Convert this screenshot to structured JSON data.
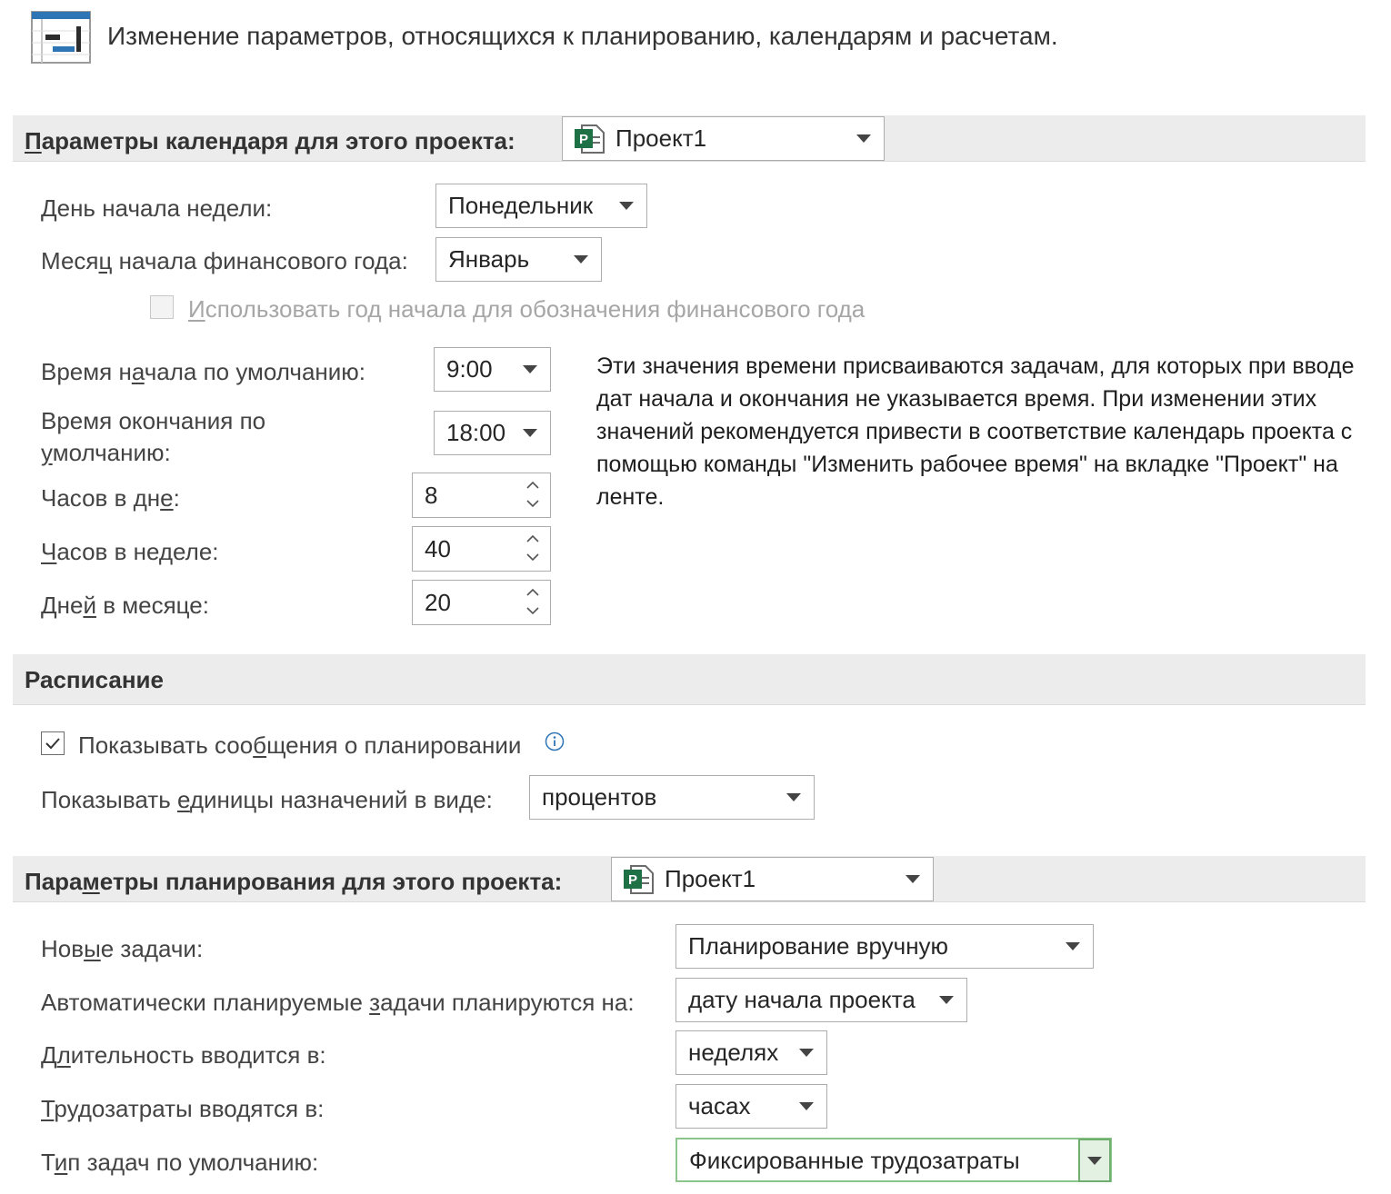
{
  "header": {
    "text": "Изменение параметров, относящихся к планированию, календарям и расчетам."
  },
  "calendar": {
    "title_first": "П",
    "title_rest": "араметры календаря для этого проекта:",
    "project": "Проект1",
    "week_start": {
      "label": "День начала недели:",
      "value": "Понедельник"
    },
    "fiscal_month": {
      "label_a": "Меся",
      "label_u": "ц",
      "label_b": " начала финансового года:",
      "value": "Январь"
    },
    "use_start_year": {
      "label_u": "И",
      "label_rest": "спользовать год начала для обозначения финансового года",
      "checked": false
    },
    "default_start": {
      "label_a": "Время н",
      "label_u": "а",
      "label_b": "чала по умолчанию:",
      "value": "9:00"
    },
    "default_end": {
      "label_line1": "Время окончания по",
      "label_u": "у",
      "label_line2": "молчанию:",
      "value": "18:00"
    },
    "hours_day": {
      "label_a": "Часов в дн",
      "label_u": "е",
      "label_b": ":",
      "value": "8"
    },
    "hours_week": {
      "label_u": "Ч",
      "label_rest": "асов в неделе:",
      "value": "40"
    },
    "days_month": {
      "label_a": "Дне",
      "label_u": "й",
      "label_b": " в месяце:",
      "value": "20"
    },
    "description": "Эти значения времени присваиваются задачам, для которых при вводе дат начала и окончания не указывается время. При изменении этих значений рекомендуется привести в соответствие календарь проекта с помощью команды \"Изменить рабочее время\" на вкладке \"Проект\" на ленте."
  },
  "schedule": {
    "title": "Расписание",
    "show_messages": {
      "label_a": "Показывать соо",
      "label_u": "б",
      "label_b": "щения о планировании",
      "checked": true
    },
    "units": {
      "label_a": "Показывать ",
      "label_u": "е",
      "label_b": "диницы назначений в виде:",
      "value": "процентов"
    }
  },
  "planning": {
    "title_a": "Пара",
    "title_u": "м",
    "title_b": "етры планирования для этого проекта:",
    "project": "Проект1",
    "new_tasks": {
      "label_a": "Нов",
      "label_u": "ы",
      "label_b": "е задачи:",
      "value": "Планирование вручную"
    },
    "auto_tasks": {
      "label_a": "Автоматически планируемые ",
      "label_u": "з",
      "label_b": "адачи планируются на:",
      "value": "дату начала проекта"
    },
    "duration": {
      "label_a": "Д",
      "label_u": "л",
      "label_b": "ительность вводится в:",
      "value": "неделях"
    },
    "work": {
      "label_u": "Т",
      "label_rest": "рудозатраты вводятся в:",
      "value": "часах"
    },
    "task_type": {
      "label_a": "Т",
      "label_u": "и",
      "label_b": "п задач по умолчанию:",
      "value": "Фиксированные трудозатраты"
    }
  }
}
